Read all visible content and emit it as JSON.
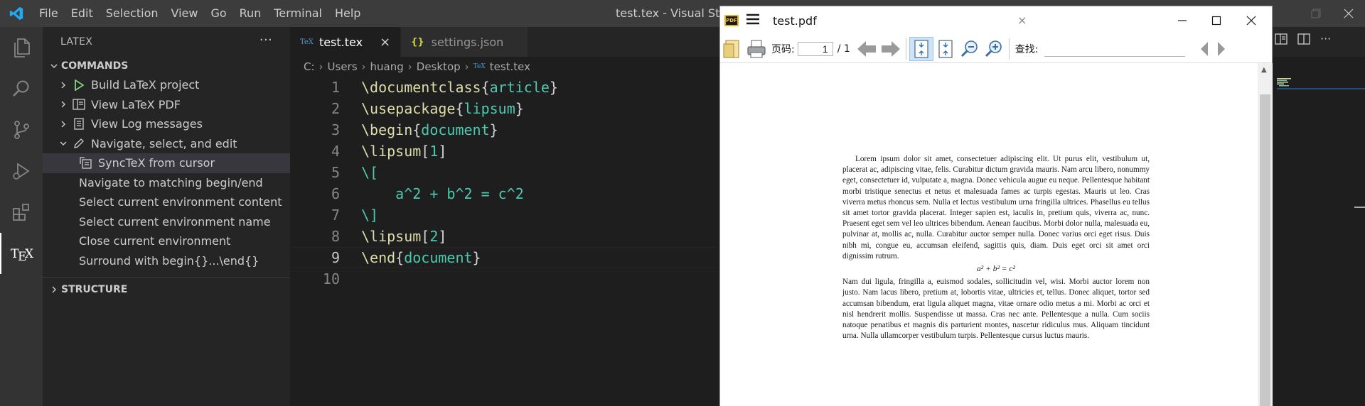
{
  "titlebar": {
    "menu": [
      "File",
      "Edit",
      "Selection",
      "View",
      "Go",
      "Run",
      "Terminal",
      "Help"
    ],
    "title": "test.tex - Visual Studio"
  },
  "sidebar": {
    "title": "LATEX",
    "commands_label": "COMMANDS",
    "items": [
      {
        "label": "Build LaTeX project"
      },
      {
        "label": "View LaTeX PDF"
      },
      {
        "label": "View Log messages"
      },
      {
        "label": "Navigate, select, and edit"
      }
    ],
    "sub_items": [
      {
        "label": "SyncTeX from cursor"
      },
      {
        "label": "Navigate to matching begin/end"
      },
      {
        "label": "Select current environment content"
      },
      {
        "label": "Select current environment name"
      },
      {
        "label": "Close current environment"
      },
      {
        "label": "Surround with begin{}...\\end{}"
      }
    ],
    "structure_label": "STRUCTURE"
  },
  "editor": {
    "tabs": [
      {
        "label": "test.tex",
        "active": true
      },
      {
        "label": "settings.json",
        "active": false
      }
    ],
    "breadcrumb": [
      "C:",
      "Users",
      "huang",
      "Desktop",
      "test.tex"
    ],
    "current_line": 9,
    "line_numbers": [
      "1",
      "2",
      "3",
      "4",
      "5",
      "6",
      "7",
      "8",
      "9",
      "10"
    ],
    "lines": [
      {
        "cmd": "\\documentclass",
        "open": "{",
        "arg": "article",
        "close": "}"
      },
      {
        "cmd": "\\usepackage",
        "open": "{",
        "arg": "lipsum",
        "close": "}"
      },
      {
        "cmd": "\\begin",
        "open": "{",
        "arg": "document",
        "close": "}"
      },
      {
        "cmd": "\\lipsum",
        "open": "[",
        "arg": "1",
        "close": "]"
      },
      {
        "text": "\\["
      },
      {
        "text": "    a^2 + b^2 = c^2"
      },
      {
        "text": "\\]"
      },
      {
        "cmd": "\\lipsum",
        "open": "[",
        "arg": "2",
        "close": "]"
      },
      {
        "cmd": "\\end",
        "open": "{",
        "arg": "document",
        "close": "}"
      },
      {
        "text": ""
      }
    ]
  },
  "pdf_viewer": {
    "filename": "test.pdf",
    "page_label": "页码:",
    "page_value": "1",
    "page_total": "/ 1",
    "find_label": "查找:",
    "paragraph1": "Lorem ipsum dolor sit amet, consectetuer adipiscing elit. Ut purus elit, vestibulum ut, placerat ac, adipiscing vitae, felis. Curabitur dictum gravida mauris. Nam arcu libero, nonummy eget, consectetuer id, vulputate a, magna. Donec vehicula augue eu neque. Pellentesque habitant morbi tristique senectus et netus et malesuada fames ac turpis egestas. Mauris ut leo. Cras viverra metus rhoncus sem. Nulla et lectus vestibulum urna fringilla ultrices. Phasellus eu tellus sit amet tortor gravida placerat. Integer sapien est, iaculis in, pretium quis, viverra ac, nunc. Praesent eget sem vel leo ultrices bibendum. Aenean faucibus. Morbi dolor nulla, malesuada eu, pulvinar at, mollis ac, nulla. Curabitur auctor semper nulla. Donec varius orci eget risus. Duis nibh mi, congue eu, accumsan eleifend, sagittis quis, diam. Duis eget orci sit amet orci dignissim rutrum.",
    "equation": "a² + b² = c²",
    "paragraph2": "Nam dui ligula, fringilla a, euismod sodales, sollicitudin vel, wisi. Morbi auctor lorem non justo. Nam lacus libero, pretium at, lobortis vitae, ultricies et, tellus. Donec aliquet, tortor sed accumsan bibendum, erat ligula aliquet magna, vitae ornare odio metus a mi. Morbi ac orci et nisl hendrerit mollis. Suspendisse ut massa. Cras nec ante. Pellentesque a nulla. Cum sociis natoque penatibus et magnis dis parturient montes, nascetur ridiculus mus. Aliquam tincidunt urna. Nulla ullamcorper vestibulum turpis. Pellentesque cursus luctus mauris."
  },
  "colors": {
    "accent": "#007acc",
    "activity_bar": "#333333",
    "sidebar": "#252526",
    "editor_bg": "#1e1e1e",
    "latex_command": "#dcdcaa",
    "latex_argument": "#4ec9b0"
  }
}
